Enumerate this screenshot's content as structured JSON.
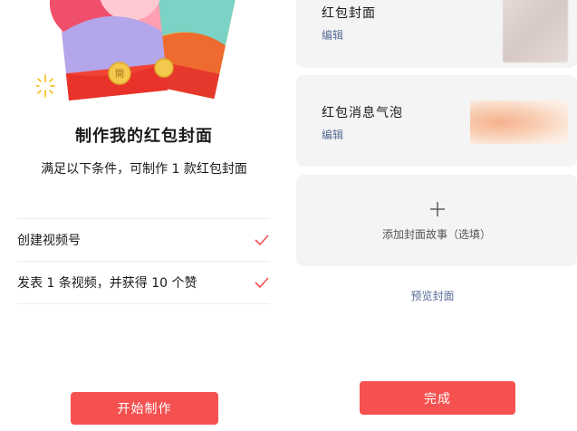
{
  "left_panel": {
    "title": "制作我的红包封面",
    "subtitle": "满足以下条件，可制作 1 款红包封面",
    "conditions": [
      {
        "label": "创建视频号",
        "done": true
      },
      {
        "label": "发表 1 条视频，并获得 10 个赞",
        "done": true
      }
    ],
    "start_button": "开始制作",
    "coin_glyph": "開",
    "colors": {
      "accent": "#f55150",
      "check": "#f55150"
    }
  },
  "right_panel": {
    "cover_card": {
      "title": "红包封面",
      "edit": "编辑"
    },
    "bubble_card": {
      "title": "红包消息气泡",
      "edit": "编辑"
    },
    "story_card": {
      "label": "添加封面故事（选填）"
    },
    "preview_link": "预览封面",
    "done_button": "完成",
    "colors": {
      "link": "#576b95",
      "card_bg": "#f4f4f4",
      "accent": "#f55150"
    }
  }
}
